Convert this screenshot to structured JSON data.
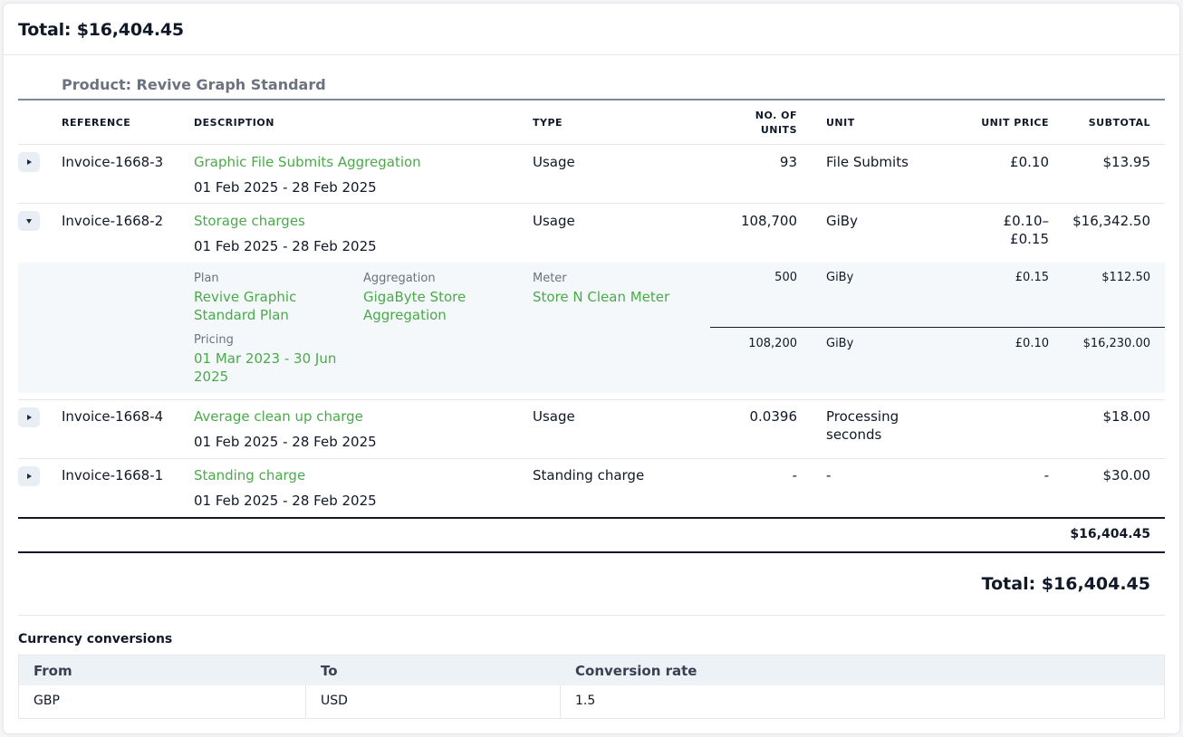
{
  "summary": {
    "total_label": "Total: $16,404.45"
  },
  "product": {
    "title": "Product: Revive Graph Standard"
  },
  "columns": {
    "reference": "REFERENCE",
    "description": "DESCRIPTION",
    "type": "TYPE",
    "units_line1": "NO. OF",
    "units_line2": "UNITS",
    "unit": "UNIT",
    "unit_price": "UNIT PRICE",
    "subtotal": "SUBTOTAL"
  },
  "rows": [
    {
      "reference": "Invoice-1668-3",
      "description": "Graphic File Submits Aggregation",
      "period": "01 Feb 2025 - 28 Feb 2025",
      "type": "Usage",
      "units": "93",
      "unit": "File Submits",
      "unit_price": "£0.10",
      "subtotal": "$13.95"
    },
    {
      "reference": "Invoice-1668-2",
      "description": "Storage charges",
      "period": "01 Feb 2025 - 28 Feb 2025",
      "type": "Usage",
      "units": "108,700",
      "unit": "GiBy",
      "unit_price_line1": "£0.10–",
      "unit_price_line2": "£0.15",
      "subtotal": "$16,342.50",
      "details": {
        "plan_label": "Plan",
        "plan_line1": "Revive Graphic",
        "plan_line2": "Standard Plan",
        "aggregation_label": "Aggregation",
        "aggregation_line1": "GigaByte Store",
        "aggregation_line2": "Aggregation",
        "meter_label": "Meter",
        "meter": "Store N Clean Meter",
        "pricing_label": "Pricing",
        "pricing_line1": "01 Mar 2023 - 30 Jun",
        "pricing_line2": "2025",
        "tiers": [
          {
            "units": "500",
            "unit": "GiBy",
            "unit_price": "£0.15",
            "subtotal": "$112.50"
          },
          {
            "units": "108,200",
            "unit": "GiBy",
            "unit_price": "£0.10",
            "subtotal": "$16,230.00"
          }
        ]
      }
    },
    {
      "reference": "Invoice-1668-4",
      "description": "Average clean up charge",
      "period": "01 Feb 2025 - 28 Feb 2025",
      "type": "Usage",
      "units": "0.0396",
      "unit_line1": "Processing",
      "unit_line2": "seconds",
      "unit_price": "",
      "subtotal": "$18.00"
    },
    {
      "reference": "Invoice-1668-1",
      "description": "Standing charge",
      "period": "01 Feb 2025 - 28 Feb 2025",
      "type": "Standing charge",
      "units": "-",
      "unit": "-",
      "unit_price": "-",
      "subtotal": "$30.00"
    }
  ],
  "sum": "$16,404.45",
  "grand_total_label": "Total: $16,404.45",
  "currency": {
    "title": "Currency conversions",
    "headers": {
      "from": "From",
      "to": "To",
      "rate": "Conversion rate"
    },
    "row": {
      "from": "GBP",
      "to": "USD",
      "rate": "1.5"
    }
  },
  "colors": {
    "link": "#4aaa4a",
    "muted": "#6b7280",
    "panel": "#f5f8fb"
  }
}
